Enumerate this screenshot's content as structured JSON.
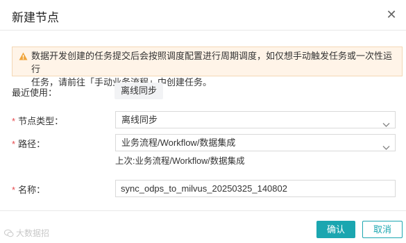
{
  "dialog": {
    "title": "新建节点",
    "close_symbol": "✕"
  },
  "alert": {
    "icon": "warning-icon",
    "color": "#f0a43a",
    "line1": "数据开发创建的任务提交后会按照调度配置进行周期调度，如仅想手动触发任务或一次性运行",
    "line2": "任务，请前往「手动业务流程」中创建任务。"
  },
  "recent": {
    "label": "最近使用：",
    "chip": "离线同步"
  },
  "node_type": {
    "required_mark": "*",
    "label": "节点类型：",
    "value": "离线同步"
  },
  "path": {
    "required_mark": "*",
    "label": "路径：",
    "value": "业务流程/Workflow/数据集成",
    "last_hint": "上次:业务流程/Workflow/数据集成"
  },
  "name": {
    "required_mark": "*",
    "label": "名称：",
    "value": "sync_odps_to_milvus_20250325_140802"
  },
  "footer": {
    "watermark": "大数据招",
    "ok_label": "确认",
    "cancel_label": "取消",
    "accent": "#1ba6b0"
  }
}
